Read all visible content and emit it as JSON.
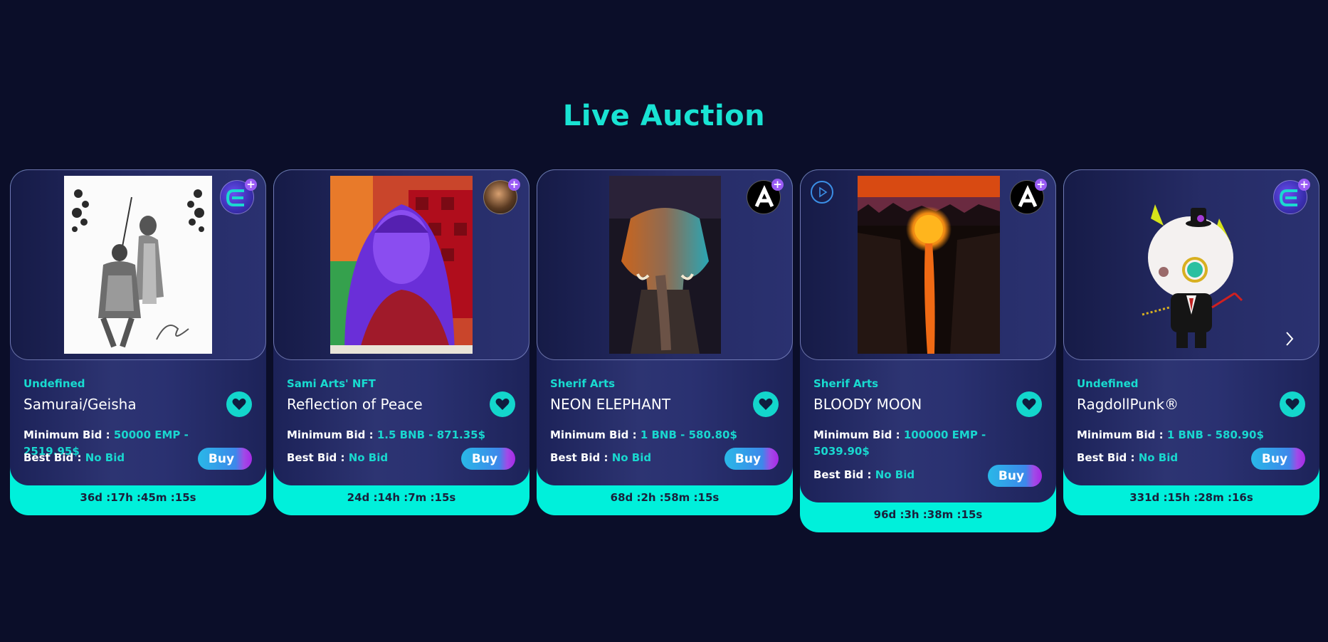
{
  "section": {
    "title": "Live Auction"
  },
  "cards": [
    {
      "collection": "Undefined",
      "name": "Samurai/Geisha",
      "min_bid_label": "Minimum Bid :",
      "min_bid_value": "50000 EMP - 2519.95$",
      "best_bid_label": "Best Bid :",
      "best_bid_value": "No Bid",
      "buy_label": "Buy",
      "timer": "36d :17h :45m :15s",
      "creator_icon": "elrond-logo-icon"
    },
    {
      "collection": "Sami Arts' NFT",
      "name": "Reflection of Peace",
      "min_bid_label": "Minimum Bid :",
      "min_bid_value": "1.5 BNB - 871.35$",
      "best_bid_label": "Best Bid :",
      "best_bid_value": "No Bid",
      "buy_label": "Buy",
      "timer": "24d :14h :7m :15s",
      "creator_icon": "artist-avatar"
    },
    {
      "collection": "Sherif Arts",
      "name": "NEON ELEPHANT",
      "min_bid_label": "Minimum Bid :",
      "min_bid_value": "1 BNB - 580.80$",
      "best_bid_label": "Best Bid :",
      "best_bid_value": "No Bid",
      "buy_label": "Buy",
      "timer": "68d :2h :58m :15s",
      "creator_icon": "sherif-arts-logo-icon"
    },
    {
      "collection": "Sherif Arts",
      "name": "BLOODY MOON",
      "min_bid_label": "Minimum Bid :",
      "min_bid_value": "100000 EMP - 5039.90$",
      "best_bid_label": "Best Bid :",
      "best_bid_value": "No Bid",
      "buy_label": "Buy",
      "timer": "96d :3h :38m :15s",
      "creator_icon": "sherif-arts-logo-icon"
    },
    {
      "collection": "Undefined",
      "name": "RagdollPunk®",
      "min_bid_label": "Minimum Bid :",
      "min_bid_value": "1 BNB - 580.90$",
      "best_bid_label": "Best Bid :",
      "best_bid_value": "No Bid",
      "buy_label": "Buy",
      "timer": "331d :15h :28m :16s",
      "creator_icon": "elrond-logo-icon"
    }
  ],
  "colors": {
    "accent": "#19e3d3",
    "background": "#0b0e29",
    "timer_bar": "#00f0db"
  }
}
